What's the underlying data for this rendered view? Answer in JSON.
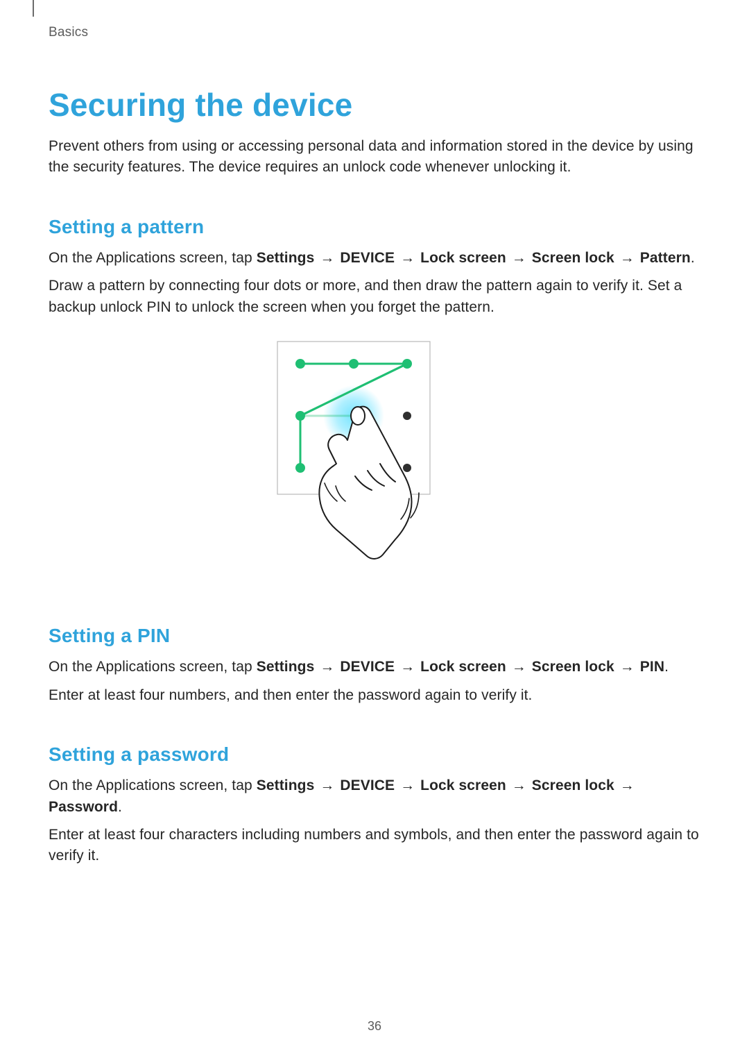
{
  "header": {
    "section": "Basics"
  },
  "title": "Securing the device",
  "intro": "Prevent others from using or accessing personal data and information stored in the device by using the security features. The device requires an unlock code whenever unlocking it.",
  "arrow": "→",
  "pattern": {
    "heading": "Setting a pattern",
    "lead": "On the Applications screen, tap ",
    "path": [
      "Settings",
      "DEVICE",
      "Lock screen",
      "Screen lock",
      "Pattern"
    ],
    "trail": ".",
    "body": "Draw a pattern by connecting four dots or more, and then draw the pattern again to verify it. Set a backup unlock PIN to unlock the screen when you forget the pattern."
  },
  "pin": {
    "heading": "Setting a PIN",
    "lead": "On the Applications screen, tap ",
    "path": [
      "Settings",
      "DEVICE",
      "Lock screen",
      "Screen lock",
      "PIN"
    ],
    "trail": ".",
    "body": "Enter at least four numbers, and then enter the password again to verify it."
  },
  "password": {
    "heading": "Setting a password",
    "lead": "On the Applications screen, tap ",
    "path": [
      "Settings",
      "DEVICE",
      "Lock screen",
      "Screen lock",
      "Password"
    ],
    "trail": ".",
    "body": "Enter at least four characters including numbers and symbols, and then enter the password again to verify it."
  },
  "pageNumber": "36"
}
